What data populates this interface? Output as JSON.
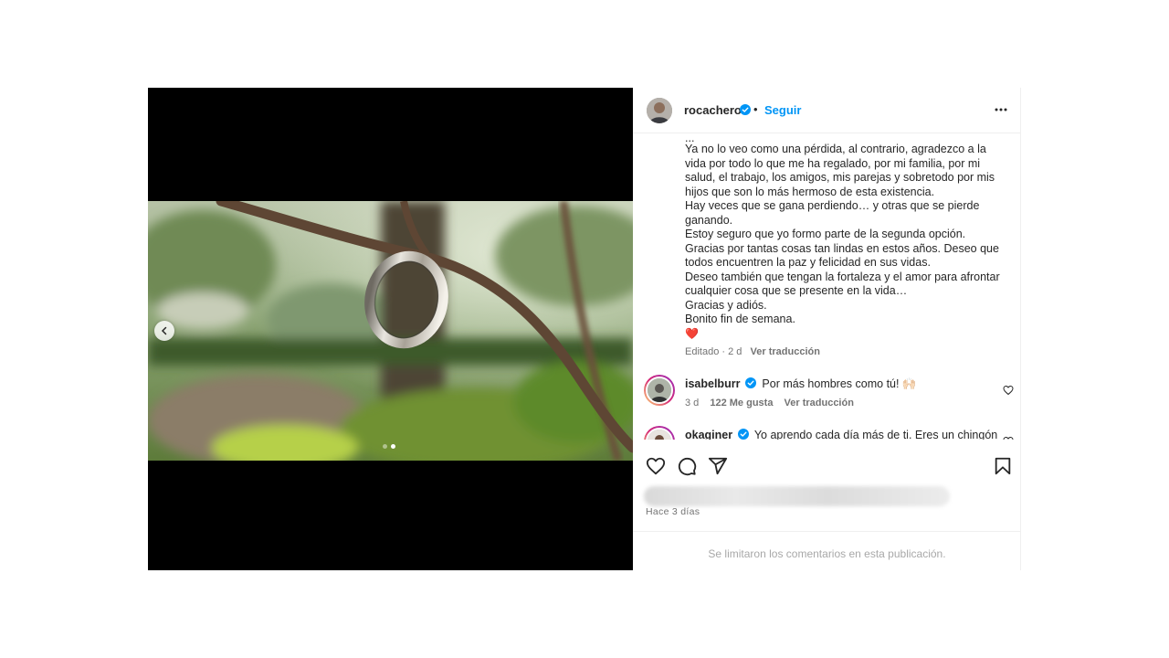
{
  "post": {
    "username": "rocachero",
    "separator": "•",
    "follow_label": "Seguir",
    "more_icon": "more-horizontal-icon"
  },
  "media": {
    "carousel_index": 2,
    "carousel_total": 2
  },
  "caption": {
    "lines": [
      "...",
      "Ya no lo veo como una pérdida, al contrario, agradezco a la",
      "vida por todo lo que me ha regalado, por mi familia, por mi",
      "salud, el trabajo, los amigos, mis parejas y sobretodo por mis",
      "hijos que son lo más hermoso de esta existencia.",
      "Hay veces que se gana perdiendo… y otras que se pierde",
      "ganando.",
      "Estoy seguro que yo formo parte de la segunda opción.",
      "Gracias por tantas cosas tan lindas en estos años. Deseo que",
      "todos encuentren la paz y felicidad en sus vidas.",
      "Deseo también que tengan la fortaleza y el amor para afrontar",
      "cualquier cosa que se presente en la vida…",
      "Gracias y adiós.",
      "Bonito fin de semana.",
      "❤️"
    ],
    "edited": "Editado · 2 d",
    "translate": "Ver traducción"
  },
  "comments": [
    {
      "username": "isabelburr",
      "text": "Por más hombres como tú! 🙌🏻",
      "time": "3 d",
      "likes": "122 Me gusta",
      "translate": "Ver traducción"
    },
    {
      "username": "okaginer",
      "text": "Yo aprendo cada día más de ti. Eres un chingón"
    }
  ],
  "footer": {
    "time_ago": "Hace 3 días",
    "comments_limited": "Se limitaron los comentarios en esta publicación."
  },
  "colors": {
    "accent": "#0095f6",
    "verified": "#0095f6",
    "text": "#262626",
    "muted": "#737373"
  }
}
